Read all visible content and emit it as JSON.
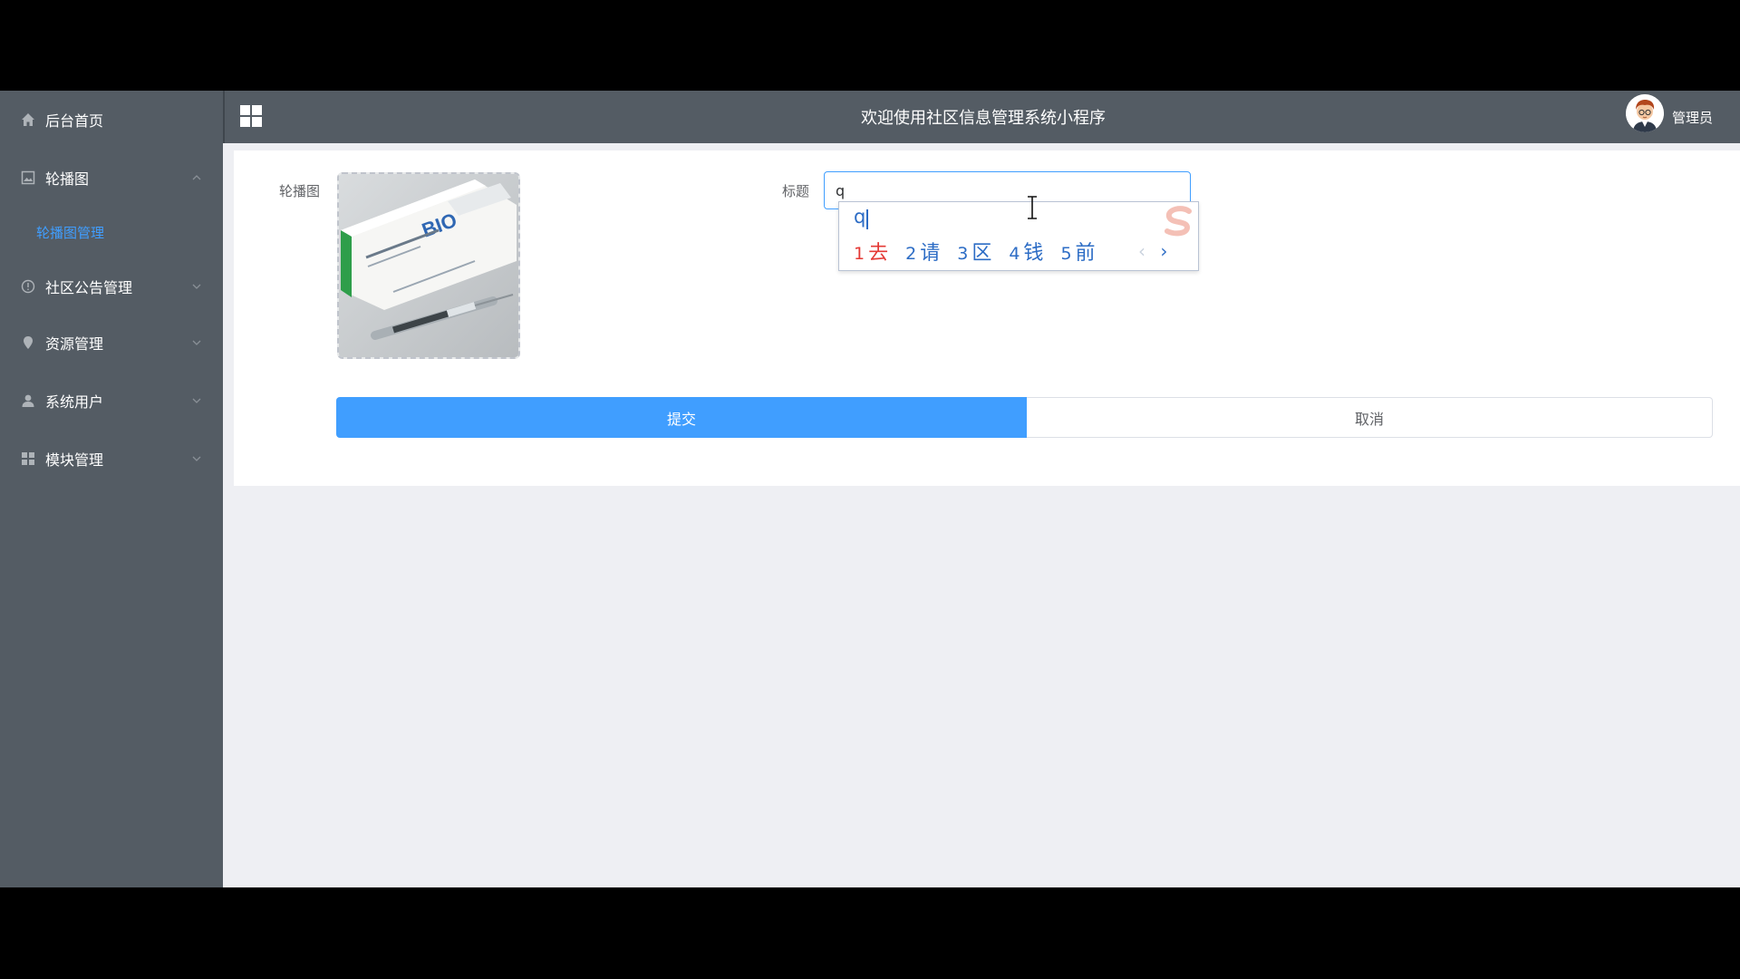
{
  "sidebar": {
    "items": [
      {
        "label": "后台首页",
        "icon": "home-icon"
      },
      {
        "label": "轮播图",
        "icon": "image-icon",
        "expanded": true
      },
      {
        "label": "社区公告管理",
        "icon": "info-circle-icon"
      },
      {
        "label": "资源管理",
        "icon": "location-icon"
      },
      {
        "label": "系统用户",
        "icon": "user-icon"
      },
      {
        "label": "模块管理",
        "icon": "grid-icon"
      }
    ],
    "submenu": {
      "label": "轮播图管理"
    }
  },
  "header": {
    "title": "欢迎使用社区信息管理系统小程序",
    "user": "管理员"
  },
  "form": {
    "carousel_label": "轮播图",
    "title_label": "标题",
    "title_value": "q",
    "submit": "提交",
    "cancel": "取消"
  },
  "ime": {
    "composition": "q",
    "candidates": [
      {
        "num": "1",
        "text": "去"
      },
      {
        "num": "2",
        "text": "请"
      },
      {
        "num": "3",
        "text": "区"
      },
      {
        "num": "4",
        "text": "钱"
      },
      {
        "num": "5",
        "text": "前"
      }
    ],
    "prev": "‹",
    "next": "›"
  },
  "colors": {
    "sidebar_bg": "#545c64",
    "accent": "#409eff",
    "page_bg": "#eeeff3"
  }
}
